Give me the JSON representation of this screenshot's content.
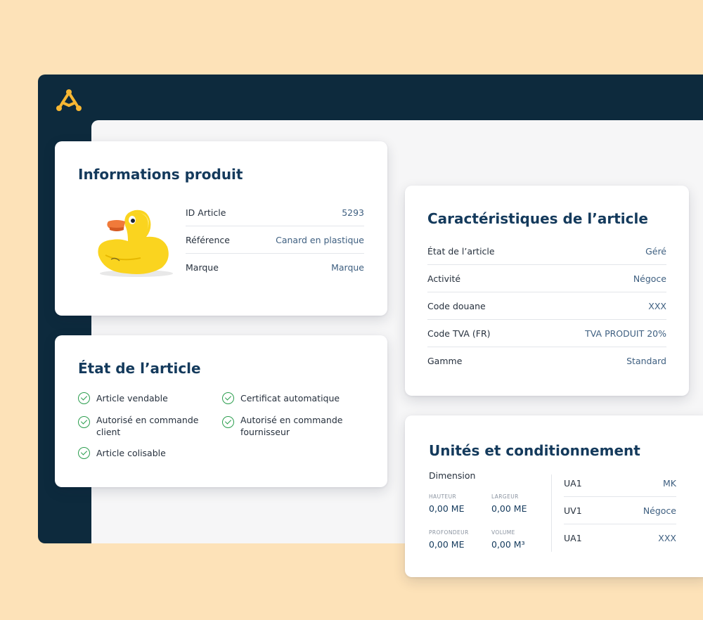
{
  "brand": {
    "logo_icon": "molecule-logo-icon",
    "logo_color": "#f7b733"
  },
  "info_card": {
    "title": "Informations produit",
    "image_icon": "rubber-duck-image",
    "rows": [
      {
        "key": "ID Article",
        "value": "5293"
      },
      {
        "key": "Référence",
        "value": "Canard en plastique"
      },
      {
        "key": "Marque",
        "value": "Marque"
      }
    ]
  },
  "etat_card": {
    "title": "État de l’article",
    "items": [
      {
        "label": "Article vendable"
      },
      {
        "label": "Certificat automatique"
      },
      {
        "label": "Autorisé en commande client"
      },
      {
        "label": "Autorisé en commande fournisseur"
      },
      {
        "label": "Article colisable"
      }
    ],
    "check_color": "#2a9d4d"
  },
  "carac_card": {
    "title": "Caractéristiques de l’article",
    "rows": [
      {
        "key": "État de l’article",
        "value": "Géré"
      },
      {
        "key": "Activité",
        "value": "Négoce"
      },
      {
        "key": "Code douane",
        "value": "XXX"
      },
      {
        "key": "Code TVA (FR)",
        "value": "TVA PRODUIT 20%"
      },
      {
        "key": "Gamme",
        "value": "Standard"
      }
    ]
  },
  "unites_card": {
    "title": "Unités et conditionnement",
    "dimension_label": "Dimension",
    "dimensions": [
      {
        "caption": "HAUTEUR",
        "value": "0,00 ME"
      },
      {
        "caption": "LARGEUR",
        "value": "0,00 ME"
      },
      {
        "caption": "PROFONDEUR",
        "value": "0,00 ME"
      },
      {
        "caption": "VOLUME",
        "value": "0,00 M³"
      }
    ],
    "units": [
      {
        "key": "UA1",
        "value": "MK"
      },
      {
        "key": "UV1",
        "value": "Négoce"
      },
      {
        "key": "UA1",
        "value": "XXX"
      }
    ]
  },
  "colors": {
    "background": "#fde2b8",
    "sidebar": "#0d2a3d",
    "title": "#143a5c"
  }
}
